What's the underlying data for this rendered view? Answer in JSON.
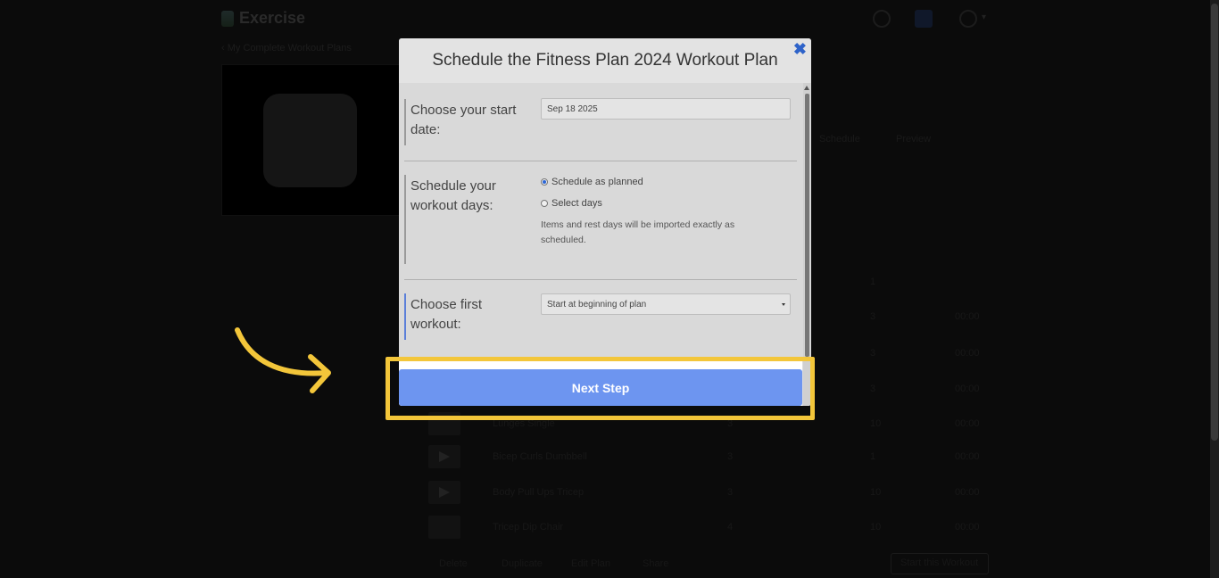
{
  "background": {
    "app_title": "Exercise",
    "back_link": "‹ My Complete Workout Plans",
    "tabs": [
      "Schedule",
      "Preview"
    ],
    "rows": [
      {
        "name": "",
        "n1": "1",
        "n2": "",
        "n3": ""
      },
      {
        "name": "",
        "n1": "3",
        "n2": "",
        "n3": "00:00"
      },
      {
        "name": "",
        "n1": "3",
        "n2": "",
        "n3": "00:00"
      },
      {
        "name": "",
        "n1": "3",
        "n2": "",
        "n3": "00:00"
      },
      {
        "name": "Lunges Single",
        "n1": "3",
        "n2": "10",
        "n3": "00:00"
      },
      {
        "name": "Bicep Curls Dumbbell",
        "n1": "3",
        "n2": "1",
        "n3": "00:00"
      },
      {
        "name": "Body Pull Ups Tricep",
        "n1": "3",
        "n2": "10",
        "n3": "00:00"
      },
      {
        "name": "Tricep Dip Chair",
        "n1": "4",
        "n2": "10",
        "n3": "00:00"
      }
    ],
    "footer_links": [
      "Delete",
      "Duplicate",
      "Edit Plan",
      "Share"
    ],
    "footer_button": "Start this Workout"
  },
  "modal": {
    "title": "Schedule the Fitness Plan 2024 Workout Plan",
    "close_label": "✖",
    "start_date_label": "Choose your start date:",
    "start_date_value": "Sep 18 2025",
    "workout_days_label": "Schedule your workout days:",
    "radio_options": [
      "Schedule as planned",
      "Select days"
    ],
    "selected_option": "Schedule as planned",
    "help_text": "Items and rest days will be imported exactly as scheduled.",
    "first_workout_label": "Choose first workout:",
    "first_workout_value": "Start at beginning of plan",
    "next_button": "Next Step"
  },
  "colors": {
    "highlight": "#f3c63a",
    "accent_blue": "#6d95f0",
    "active_section": "#5b7fd9"
  },
  "icons": [
    "help-circle-icon",
    "message-icon",
    "user-avatar-icon",
    "chevron-down-icon",
    "close-icon",
    "annotation-arrow-icon"
  ]
}
